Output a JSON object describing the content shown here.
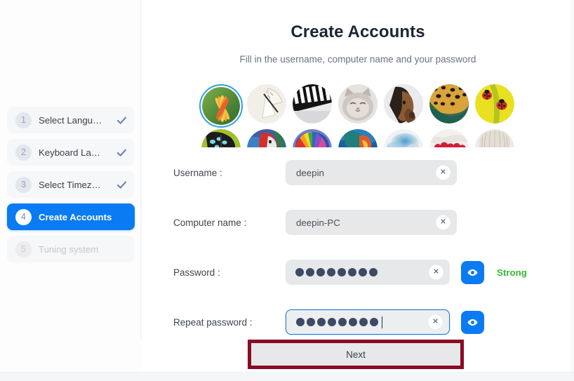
{
  "sidebar": {
    "steps": [
      {
        "number": "1",
        "label": "Select Langu…",
        "state": "done",
        "icon": "check-icon"
      },
      {
        "number": "2",
        "label": "Keyboard La…",
        "state": "done",
        "icon": "check-icon"
      },
      {
        "number": "3",
        "label": "Select Timez…",
        "state": "done",
        "icon": "check-icon"
      },
      {
        "number": "4",
        "label": "Create Accounts",
        "state": "current",
        "icon": ""
      },
      {
        "number": "5",
        "label": "Tuning system",
        "state": "pending",
        "icon": ""
      }
    ]
  },
  "main": {
    "title": "Create Accounts",
    "subtitle": "Fill in the username, computer name and your password"
  },
  "avatars": {
    "selected_index": 0,
    "row1": [
      {
        "name": "avatar-flower",
        "selected": true
      },
      {
        "name": "avatar-fan",
        "selected": false
      },
      {
        "name": "avatar-piano",
        "selected": false
      },
      {
        "name": "avatar-cat",
        "selected": false
      },
      {
        "name": "avatar-horse",
        "selected": false
      },
      {
        "name": "avatar-leopard",
        "selected": false
      },
      {
        "name": "avatar-ladybug",
        "selected": false
      }
    ],
    "row2": [
      {
        "name": "avatar-butterfly",
        "selected": false
      },
      {
        "name": "avatar-parrot",
        "selected": false
      },
      {
        "name": "avatar-balloon",
        "selected": false
      },
      {
        "name": "avatar-abstract",
        "selected": false
      },
      {
        "name": "avatar-watercolor",
        "selected": false
      },
      {
        "name": "avatar-berries",
        "selected": false
      },
      {
        "name": "avatar-shell",
        "selected": false
      }
    ]
  },
  "form": {
    "username": {
      "label": "Username :",
      "value": "deepin",
      "placeholder": "",
      "clear_icon": "close-icon"
    },
    "computer_name": {
      "label": "Computer name :",
      "value": "deepin-PC",
      "placeholder": "",
      "clear_icon": "close-icon"
    },
    "password": {
      "label": "Password :",
      "masked_length": 8,
      "clear_icon": "close-icon",
      "toggle_icon": "eye-icon",
      "strength": "Strong",
      "strength_color": "#33bb33"
    },
    "repeat_password": {
      "label": "Repeat password :",
      "masked_length": 8,
      "focused": true,
      "clear_icon": "close-icon",
      "toggle_icon": "eye-icon"
    }
  },
  "footer": {
    "next_label": "Next",
    "highlight_color": "#8a0b26"
  }
}
